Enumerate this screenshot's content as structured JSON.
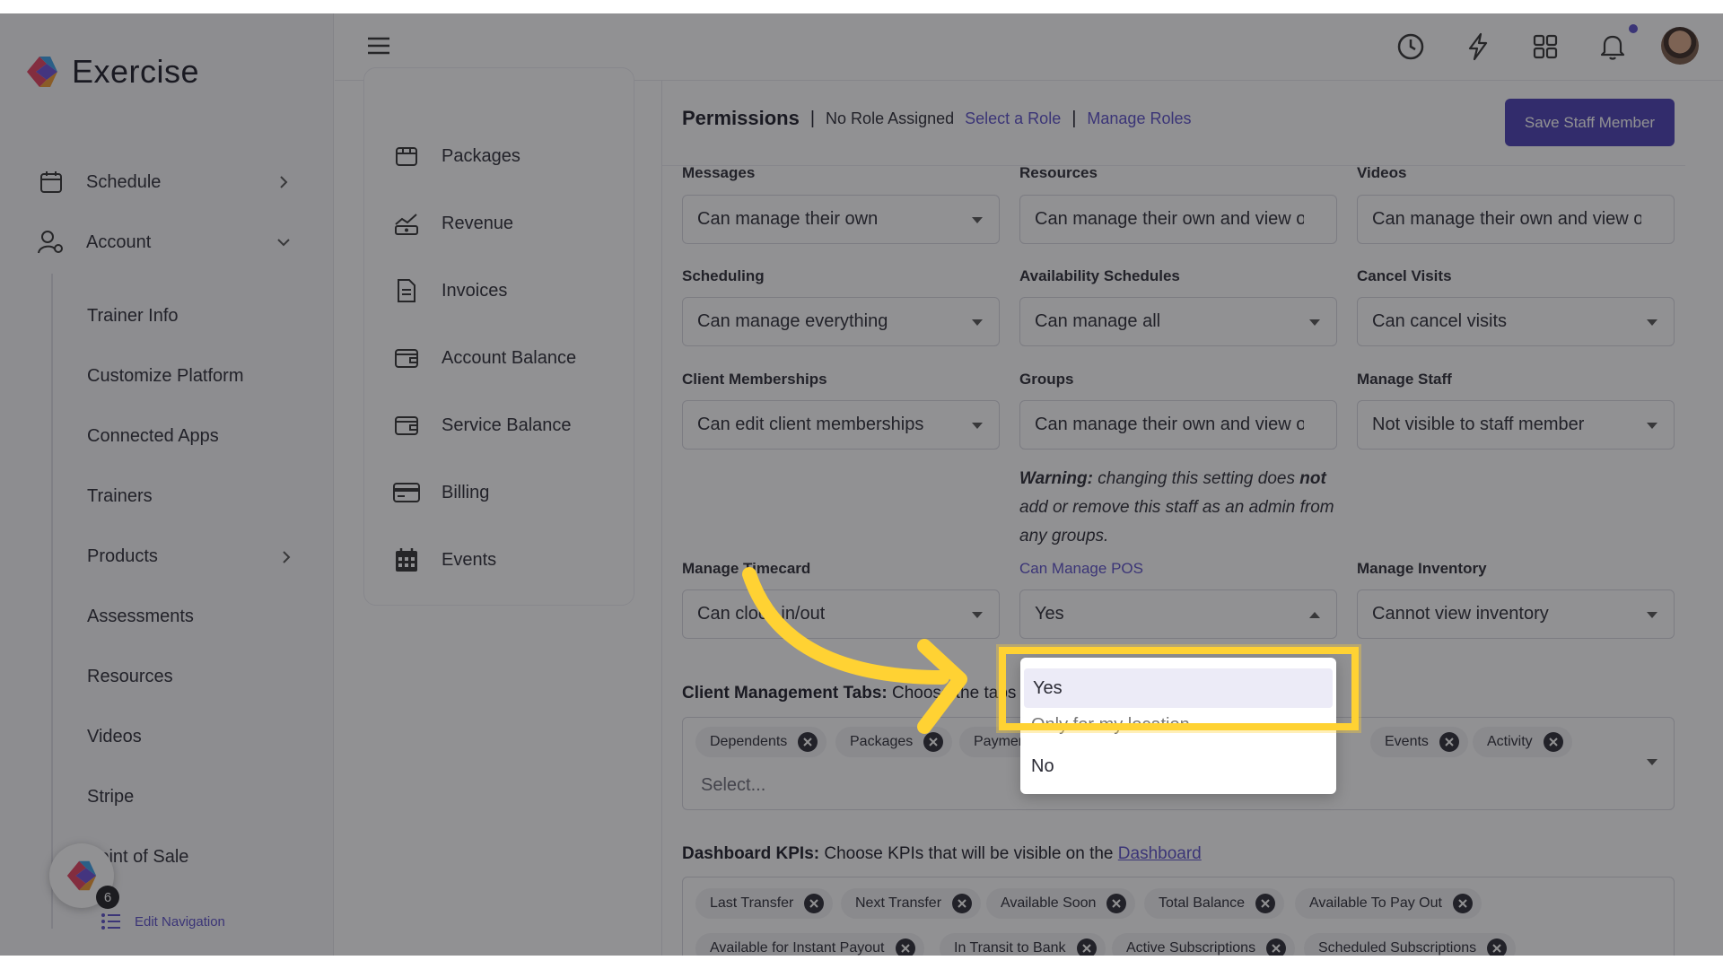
{
  "app": {
    "name": "Exercise"
  },
  "sidebar": {
    "items": [
      {
        "label": "Schedule",
        "icon": "calendar-icon"
      },
      {
        "label": "Account",
        "icon": "user-gear-icon"
      }
    ],
    "sub_items": [
      "Trainer Info",
      "Customize Platform",
      "Connected Apps",
      "Trainers",
      "Products",
      "Assessments",
      "Resources",
      "Videos",
      "Stripe",
      "Point of Sale"
    ],
    "badge_count": "6",
    "edit_navigation": "Edit Navigation"
  },
  "submenu": {
    "items": [
      "Packages",
      "Revenue",
      "Invoices",
      "Account Balance",
      "Service Balance",
      "Billing",
      "Events"
    ]
  },
  "permissions": {
    "title": "Permissions",
    "separator": "|",
    "no_role": "No Role Assigned",
    "select_role": "Select a Role",
    "manage_roles": "Manage Roles",
    "save_button": "Save Staff Member",
    "fields": {
      "messages": {
        "label": "Messages",
        "value": "Can manage their own"
      },
      "resources": {
        "label": "Resources",
        "value": "Can manage their own and view others"
      },
      "videos": {
        "label": "Videos",
        "value": "Can manage their own and view others"
      },
      "scheduling": {
        "label": "Scheduling",
        "value": "Can manage everything"
      },
      "availability": {
        "label": "Availability Schedules",
        "value": "Can manage all"
      },
      "cancel_visits": {
        "label": "Cancel Visits",
        "value": "Can cancel visits"
      },
      "client_memberships": {
        "label": "Client Memberships",
        "value": "Can edit client memberships"
      },
      "groups": {
        "label": "Groups",
        "value": "Can manage their own and view others"
      },
      "manage_staff": {
        "label": "Manage Staff",
        "value": "Not visible to staff member"
      },
      "timecard": {
        "label": "Manage Timecard",
        "value": "Can clock in/out"
      },
      "pos": {
        "label": "Can Manage POS",
        "value": "Yes"
      },
      "inventory": {
        "label": "Manage Inventory",
        "value": "Cannot view inventory"
      }
    },
    "warning_bold": "Warning:",
    "warning_1": " changing this setting does ",
    "warning_not": "not",
    "warning_2": " add or remove this staff as an admin from any groups."
  },
  "pos_dropdown": {
    "options": [
      "Yes",
      "Only for my location",
      "No"
    ],
    "selected": "Yes"
  },
  "client_tabs": {
    "title": "Client Management Tabs:",
    "desc": " Choose the tabs that will be visible on the platform.",
    "chips": [
      "Dependents",
      "Packages",
      "Payments",
      "Events",
      "Activity"
    ],
    "placeholder": "Select..."
  },
  "dashboard_kpis": {
    "title": "Dashboard KPIs:",
    "desc": " Choose KPIs that will be visible on the ",
    "link": "Dashboard",
    "chips_row1": [
      "Last Transfer",
      "Next Transfer",
      "Available Soon",
      "Total Balance",
      "Available To Pay Out"
    ],
    "chips_row2": [
      "Available for Instant Payout",
      "In Transit to Bank",
      "Active Subscriptions",
      "Scheduled Subscriptions"
    ]
  },
  "colors": {
    "accent": "#5b4fc9",
    "button": "#4a3fb4",
    "highlight": "#ffd233"
  }
}
